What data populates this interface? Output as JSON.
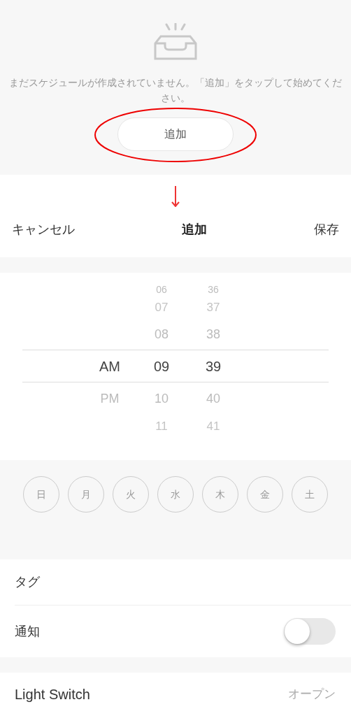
{
  "empty_state": {
    "message": "まだスケジュールが作成されていません。「追加」をタップして始めてください。",
    "button": "追加"
  },
  "header": {
    "cancel": "キャンセル",
    "title": "追加",
    "save": "保存"
  },
  "picker": {
    "columns": [
      {
        "items": [
          {
            "text": "AM",
            "selected": true
          },
          {
            "text": "PM",
            "selected": false
          }
        ]
      },
      {
        "items": [
          {
            "text": "06",
            "selected": false
          },
          {
            "text": "07",
            "selected": false
          },
          {
            "text": "08",
            "selected": false
          },
          {
            "text": "09",
            "selected": true
          },
          {
            "text": "10",
            "selected": false
          },
          {
            "text": "11",
            "selected": false
          }
        ]
      },
      {
        "items": [
          {
            "text": "36",
            "selected": false
          },
          {
            "text": "37",
            "selected": false
          },
          {
            "text": "38",
            "selected": false
          },
          {
            "text": "39",
            "selected": true
          },
          {
            "text": "40",
            "selected": false
          },
          {
            "text": "41",
            "selected": false
          }
        ]
      }
    ]
  },
  "days": [
    {
      "label": "日",
      "selected": false
    },
    {
      "label": "月",
      "selected": false
    },
    {
      "label": "火",
      "selected": false
    },
    {
      "label": "水",
      "selected": false
    },
    {
      "label": "木",
      "selected": false
    },
    {
      "label": "金",
      "selected": false
    },
    {
      "label": "土",
      "selected": false
    }
  ],
  "rows": [
    {
      "kind": "nav",
      "label": "タグ"
    },
    {
      "kind": "toggle",
      "label": "通知",
      "on": false
    }
  ],
  "device": {
    "label": "Light Switch",
    "value": "オープン"
  }
}
